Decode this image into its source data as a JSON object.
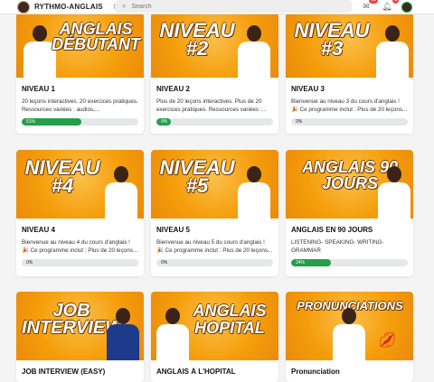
{
  "header": {
    "brand": "RYTHMO-ANGLAIS",
    "search_placeholder": "Search",
    "messages_badge": "10",
    "notifications_badge": "3"
  },
  "colors": {
    "accent": "#f59e0b",
    "progress": "#22a04b"
  },
  "courses": [
    {
      "title": "NIVEAU 1",
      "banner": "ANGLAIS DÉBUTANT",
      "desc": "20 leçons interactives. 20 exercices pratiques. Ressources variées : audios,...",
      "progress_label": "51%",
      "progress": 51
    },
    {
      "title": "NIVEAU 2",
      "banner": "NIVEAU #2",
      "desc": "Plus de 20 leçons interactives. Plus de 20 exercices pratiques. Ressources variées :...",
      "progress_label": "9%",
      "progress": 9
    },
    {
      "title": "NIVEAU 3",
      "banner": "NIVEAU #3",
      "desc": "Bienvenue au niveau 3 du cours d'anglais ! 🎉 Ce programme inclut : Plus de 20 leçons...",
      "progress_label": "0%",
      "progress": 0
    },
    {
      "title": "NIVEAU 4",
      "banner": "NIVEAU #4",
      "desc": "Bienvenue au niveau 4 du cours d'anglais ! 🎉 Ce programme inclut : Plus de 20 leçons...",
      "progress_label": "0%",
      "progress": 0
    },
    {
      "title": "NIVEAU 5",
      "banner": "NIVEAU #5",
      "desc": "Bienvenue au niveau 5 du cours d'anglais ! 🎉 Ce programme inclut : Plus de 20 leçons...",
      "progress_label": "0%",
      "progress": 0
    },
    {
      "title": "ANGLAIS EN 90 JOURS",
      "banner": "ANGLAIS 90 JOURS",
      "desc": "LISTENING- SPEAKING- WRITING- GRAMMAR",
      "progress_label": "34%",
      "progress": 34
    },
    {
      "title": "JOB INTERVIEW (EASY)",
      "banner": "JOB INTERVIEW",
      "desc": "",
      "progress_label": "",
      "progress": 0
    },
    {
      "title": "ANGLAIS À L'HOPITAL",
      "banner": "ANGLAIS HOPITAL",
      "desc": "",
      "progress_label": "",
      "progress": 0
    },
    {
      "title": "Pronunciation",
      "banner": "PRONUNCIATIONS",
      "desc": "",
      "progress_label": "",
      "progress": 0
    }
  ]
}
